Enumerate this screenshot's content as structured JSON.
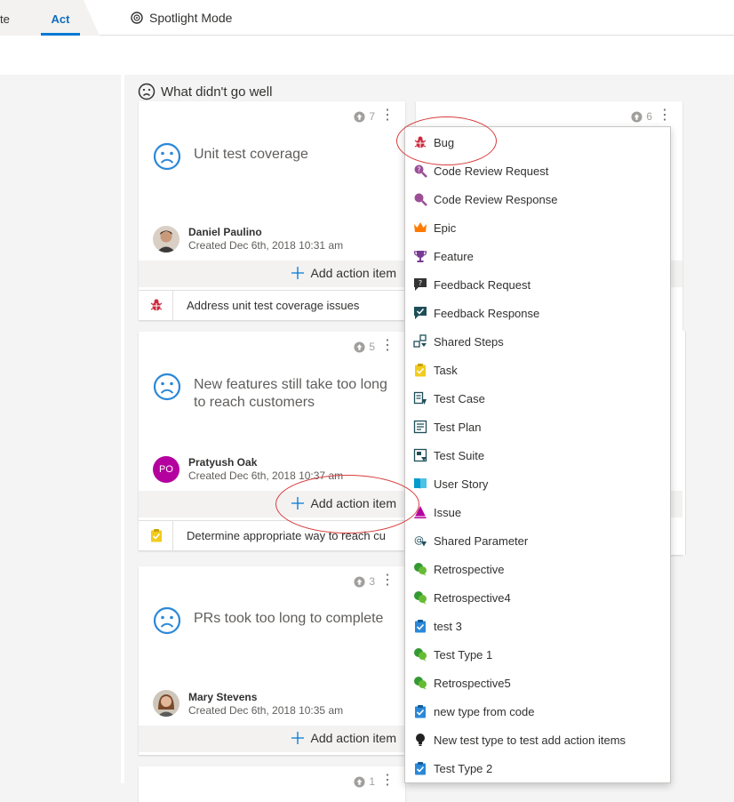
{
  "tabs": {
    "previous_tab_fragment": "te",
    "active_tab": "Act"
  },
  "spotlight_label": "Spotlight Mode",
  "column_title": "What didn't go well",
  "add_action_label": "Add action item",
  "cards": [
    {
      "title": "Unit test coverage",
      "votes": "7",
      "author": "Daniel Paulino",
      "author_initials": "",
      "created": "Created Dec 6th, 2018 10:31 am",
      "action_item": "Address unit test coverage issues",
      "action_icon": "bug-icon"
    },
    {
      "title": "New features still take too long to reach customers",
      "votes": "5",
      "author": "Pratyush Oak",
      "author_initials": "PO",
      "created": "Created Dec 6th, 2018 10:37 am",
      "action_item": "Determine appropriate way to reach customers",
      "action_icon": "task-icon"
    },
    {
      "title": "PRs took too long to complete",
      "votes": "3",
      "author": "Mary Stevens",
      "author_initials": "",
      "created": "Created Dec 6th, 2018 10:35 am",
      "action_item": "",
      "action_icon": ""
    },
    {
      "title": "",
      "votes": "1",
      "author": "",
      "author_initials": "",
      "created": "",
      "action_item": "",
      "action_icon": ""
    }
  ],
  "second_column": {
    "first_card_votes": "6"
  },
  "work_item_types": [
    {
      "label": "Bug",
      "icon": "bug-icon"
    },
    {
      "label": "Code Review Request",
      "icon": "code-review-request-icon"
    },
    {
      "label": "Code Review Response",
      "icon": "code-review-response-icon"
    },
    {
      "label": "Epic",
      "icon": "crown-icon"
    },
    {
      "label": "Feature",
      "icon": "trophy-icon"
    },
    {
      "label": "Feedback Request",
      "icon": "feedback-request-icon"
    },
    {
      "label": "Feedback Response",
      "icon": "feedback-response-icon"
    },
    {
      "label": "Shared Steps",
      "icon": "shared-steps-icon"
    },
    {
      "label": "Task",
      "icon": "task-icon"
    },
    {
      "label": "Test Case",
      "icon": "test-case-icon"
    },
    {
      "label": "Test Plan",
      "icon": "test-plan-icon"
    },
    {
      "label": "Test Suite",
      "icon": "test-suite-icon"
    },
    {
      "label": "User Story",
      "icon": "book-icon"
    },
    {
      "label": "Issue",
      "icon": "issue-icon"
    },
    {
      "label": "Shared Parameter",
      "icon": "shared-parameter-icon"
    },
    {
      "label": "Retrospective",
      "icon": "chat-icon"
    },
    {
      "label": "Retrospective4",
      "icon": "chat-icon"
    },
    {
      "label": "test 3",
      "icon": "clipboard-check-icon"
    },
    {
      "label": "Test Type 1",
      "icon": "chat-icon"
    },
    {
      "label": "Retrospective5",
      "icon": "chat-icon"
    },
    {
      "label": "new type from code",
      "icon": "clipboard-check-icon"
    },
    {
      "label": "New test type to test add action items",
      "icon": "lightbulb-icon"
    },
    {
      "label": "Test Type 2",
      "icon": "clipboard-check-icon"
    }
  ],
  "colors": {
    "accent": "#0078d4",
    "bug": "#cc293d",
    "task": "#f2cb1d",
    "annotation": "#d83b3b",
    "sad_face": "#2b88d8"
  }
}
